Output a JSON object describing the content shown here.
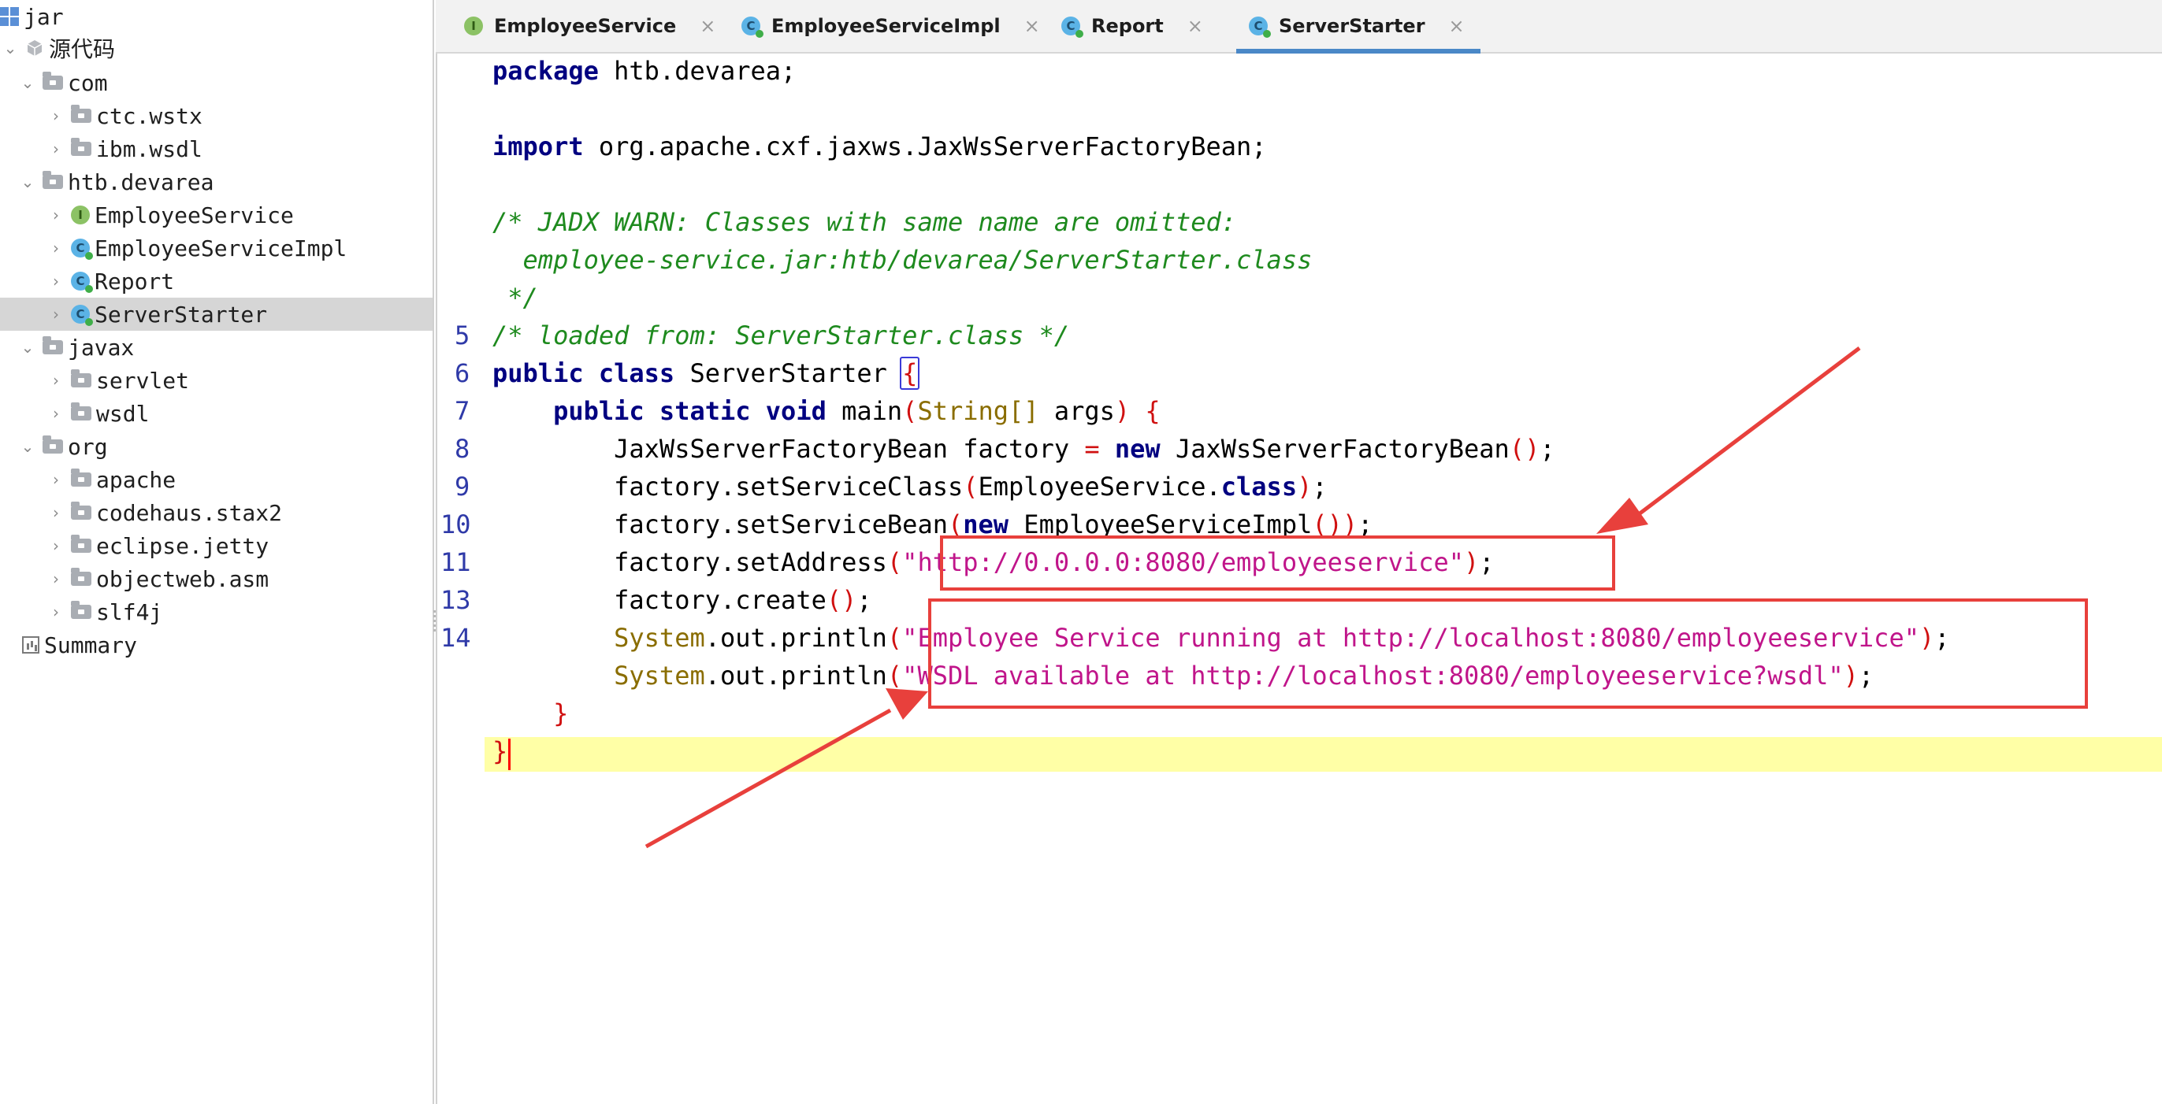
{
  "sidebar": {
    "items": [
      {
        "label": "jar",
        "icon": "jar-icon"
      },
      {
        "label": "源代码",
        "icon": "source-package-icon"
      },
      {
        "label": "com",
        "icon": "folder-icon"
      },
      {
        "label": "ctc.wstx",
        "icon": "folder-icon"
      },
      {
        "label": "ibm.wsdl",
        "icon": "folder-icon"
      },
      {
        "label": "htb.devarea",
        "icon": "folder-icon"
      },
      {
        "label": "EmployeeService",
        "icon": "interface-icon"
      },
      {
        "label": "EmployeeServiceImpl",
        "icon": "class-icon"
      },
      {
        "label": "Report",
        "icon": "class-icon"
      },
      {
        "label": "ServerStarter",
        "icon": "class-icon",
        "selected": true
      },
      {
        "label": "javax",
        "icon": "folder-icon"
      },
      {
        "label": "servlet",
        "icon": "folder-icon"
      },
      {
        "label": "wsdl",
        "icon": "folder-icon"
      },
      {
        "label": "org",
        "icon": "folder-icon"
      },
      {
        "label": "apache",
        "icon": "folder-icon"
      },
      {
        "label": "codehaus.stax2",
        "icon": "folder-icon"
      },
      {
        "label": "eclipse.jetty",
        "icon": "folder-icon"
      },
      {
        "label": "objectweb.asm",
        "icon": "folder-icon"
      },
      {
        "label": "slf4j",
        "icon": "folder-icon"
      },
      {
        "label": "Summary",
        "icon": "summary-icon"
      }
    ]
  },
  "tabs": [
    {
      "label": "EmployeeService",
      "icon_letter": "I",
      "close": "×"
    },
    {
      "label": "EmployeeServiceImpl",
      "icon_letter": "C",
      "close": "×"
    },
    {
      "label": "Report",
      "icon_letter": "C",
      "close": "×"
    },
    {
      "label": "ServerStarter",
      "icon_letter": "C",
      "close": "×",
      "active": true
    }
  ],
  "editor": {
    "line_numbers": {
      "l5": "5",
      "l6": "6",
      "l7": "7",
      "l8": "8",
      "l9": "9",
      "l10": "10",
      "l11": "11",
      "l13": "13",
      "l14": "14"
    },
    "code": {
      "package_kw": "package",
      "package_name": " htb.devarea;",
      "import_kw": "import",
      "import_name": " org.apache.cxf.jaxws.JaxWsServerFactoryBean;",
      "comment1": "/* JADX WARN: Classes with same name are omitted:",
      "comment2": "  employee-service.jar:htb/devarea/ServerStarter.class",
      "comment3": " */",
      "comment4": "/* loaded from: ServerStarter.class */",
      "l7_public": "public",
      "l7_class": "class",
      "l7_name": " ServerStarter ",
      "l7_brace": "{",
      "l8_mods": "public static void",
      "l8_main": " main",
      "l8_open": "(",
      "l8_type": "String[]",
      "l8_args": " args",
      "l8_close": ") {",
      "l9_a": "JaxWsServerFactoryBean factory ",
      "l9_eq": "=",
      "l9_new": "new",
      "l9_b": " JaxWsServerFactoryBean",
      "l9_parens": "()",
      "l9_end": ";",
      "l10_a": "factory.setServiceClass",
      "l10_open": "(",
      "l10_b": "EmployeeService.",
      "l10_kw": "class",
      "l10_close": ")",
      "l10_end": ";",
      "l11_a": "factory.setServiceBean",
      "l11_open": "(",
      "l11_new": "new",
      "l11_b": " EmployeeServiceImpl",
      "l11_parens": "())",
      "l11_end": ";",
      "l13_a": "factory.setAddress",
      "l13_open": "(",
      "l13_str": "\"http://0.0.0.0:8080/employeeservice\"",
      "l13_close": ")",
      "l13_end": ";",
      "l14_a": "factory.create",
      "l14_parens": "()",
      "l14_end": ";",
      "p1_sys": "System",
      "p1_a": ".out.println",
      "p1_open": "(",
      "p1_str": "\"Employee Service running at http://localhost:8080/employeeservice\"",
      "p1_close": ")",
      "p1_end": ";",
      "p2_sys": "System",
      "p2_a": ".out.println",
      "p2_open": "(",
      "p2_str": "\"WSDL available at http://localhost:8080/employeeservice?wsdl\"",
      "p2_close": ")",
      "p2_end": ";",
      "inner_close": "}",
      "outer_close": "}"
    }
  },
  "colors": {
    "keyword": "#000080",
    "comment": "#1e8a1e",
    "string": "#c0158a",
    "type": "#8a6d00",
    "paren": "#d01010",
    "annotation": "#e8403c",
    "current_line": "#ffffa6",
    "tab_active_underline": "#4a88c7"
  }
}
